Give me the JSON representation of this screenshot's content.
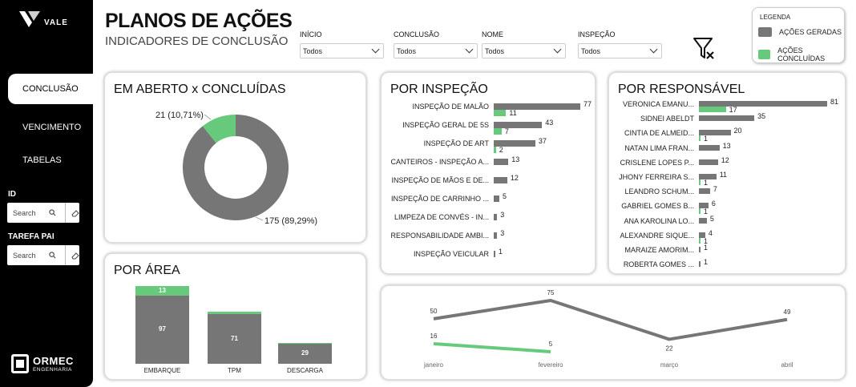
{
  "header": {
    "brand": "VALE",
    "title": "PLANOS DE AÇÕES",
    "subtitle": "INDICADORES DE CONCLUSÃO"
  },
  "colors": {
    "gerada": "#767676",
    "concluida": "#66c97c"
  },
  "nav": [
    {
      "label": "CONCLUSÃO",
      "active": true
    },
    {
      "label": "VENCIMENTO",
      "active": false
    },
    {
      "label": "TABELAS",
      "active": false
    }
  ],
  "filters": {
    "id": {
      "label": "ID",
      "placeholder": "Search"
    },
    "tarefa_pai": {
      "label": "TAREFA PAI",
      "placeholder": "Search"
    }
  },
  "slicers": [
    {
      "label": "INÍCIO",
      "value": "Todos"
    },
    {
      "label": "CONCLUSÃO",
      "value": "Todos"
    },
    {
      "label": "NOME",
      "value": "Todos"
    },
    {
      "label": "INSPEÇÃO",
      "value": "Todos"
    }
  ],
  "legend": {
    "title": "LEGENDA",
    "items": [
      "AÇÕES GERADAS",
      "AÇÕES CONCLUÍDAS"
    ]
  },
  "footer_logo": {
    "name": "ORMEC",
    "tagline": "ENGENHARIA"
  },
  "charts": {
    "donut_title": "EM ABERTO x CONCLUÍDAS",
    "inspecao_title": "POR INSPEÇÃO",
    "responsavel_title": "POR RESPONSÁVEL",
    "area_title": "POR ÁREA"
  },
  "chart_data": [
    {
      "type": "pie",
      "title": "EM ABERTO x CONCLUÍDAS",
      "slices": [
        {
          "value": 175,
          "label": "175 (89,29%)"
        },
        {
          "value": 21,
          "label": "21 (10,71%)"
        }
      ]
    },
    {
      "type": "bar",
      "title": "POR INSPEÇÃO",
      "categories": [
        "INSPEÇÃO DE MALÃO",
        "INSPEÇÃO GERAL DE 5S",
        "INSPEÇÃO DE ART",
        "CANTEIROS - INSPEÇÃO A...",
        "INSPEÇÃO DE MÃOS E DE...",
        "INSPEÇÃO DE CARRINHO ...",
        "LIMPEZA DE CONVÉS - IN...",
        "RESPONSABILIDADE AMBI...",
        "INSPEÇÃO VEICULAR"
      ],
      "series": [
        {
          "name": "AÇÕES GERADAS",
          "values": [
            77,
            43,
            37,
            13,
            12,
            5,
            3,
            3,
            1
          ]
        },
        {
          "name": "AÇÕES CONCLUÍDAS",
          "values": [
            11,
            7,
            2,
            0,
            0,
            0,
            0,
            0,
            0
          ]
        }
      ]
    },
    {
      "type": "bar",
      "title": "POR RESPONSÁVEL",
      "categories": [
        "VERONICA EMANU...",
        "SIDNEI ABELDT",
        "CINTIA DE ALMEID...",
        "NATAN LIMA FRAN...",
        "CRISLENE LOPES P...",
        "JHONY FERREIRA S...",
        "LEANDRO SCHUM...",
        "GABRIEL GOMES B...",
        "ANA KAROLINA LO...",
        "ALEXANDRE SIQUE...",
        "MARAIZE AMORIM...",
        "ROBERTA GOMES ..."
      ],
      "series": [
        {
          "name": "AÇÕES GERADAS",
          "values": [
            81,
            35,
            20,
            13,
            12,
            11,
            7,
            6,
            5,
            4,
            1,
            1
          ]
        },
        {
          "name": "AÇÕES CONCLUÍDAS",
          "values": [
            17,
            0,
            1,
            0,
            0,
            1,
            0,
            1,
            0,
            1,
            0,
            0
          ]
        }
      ]
    },
    {
      "type": "bar",
      "title": "POR ÁREA",
      "stacked": true,
      "categories": [
        "EMBARQUE",
        "TPM",
        "DESCARGA"
      ],
      "series": [
        {
          "name": "AÇÕES GERADAS",
          "values": [
            97,
            71,
            29
          ]
        },
        {
          "name": "AÇÕES CONCLUÍDAS",
          "values": [
            13,
            3,
            1
          ]
        }
      ]
    },
    {
      "type": "line",
      "categories": [
        "janeiro",
        "fevereiro",
        "março",
        "abril"
      ],
      "series": [
        {
          "name": "AÇÕES GERADAS",
          "values": [
            50,
            75,
            22,
            49
          ]
        },
        {
          "name": "AÇÕES CONCLUÍDAS",
          "values": [
            16,
            5,
            null,
            null
          ]
        }
      ]
    }
  ]
}
